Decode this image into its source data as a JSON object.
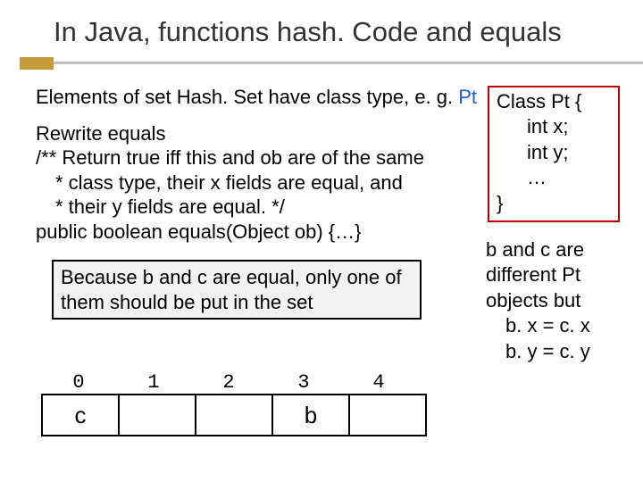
{
  "title": "In Java, functions hash. Code and equals",
  "intro_prefix": "Elements of set Hash. Set have class type, e. g. ",
  "intro_blue": "Pt",
  "rewrite": "Rewrite equals",
  "comment1": "/** Return true iff this and ob are of the same",
  "comment2": "* class type, their x fields are equal, and",
  "comment3": "* their y fields are equal. */",
  "signature": "public boolean equals(Object ob) {…}",
  "note": "Because b and c are equal, only one of them should be put in the set",
  "class_def": {
    "open": "Class Pt {",
    "field1": "int x;",
    "field2": "int y;",
    "dots": "…",
    "close": "}"
  },
  "right_note": {
    "l1": "b and c are",
    "l2": "different Pt",
    "l3": "objects but",
    "l4": "b. x = c. x",
    "l5": "b. y = c. y"
  },
  "array": {
    "labels": [
      "0",
      "1",
      "2",
      "3",
      "4"
    ],
    "cells": [
      "c",
      "",
      "",
      "b",
      ""
    ]
  }
}
